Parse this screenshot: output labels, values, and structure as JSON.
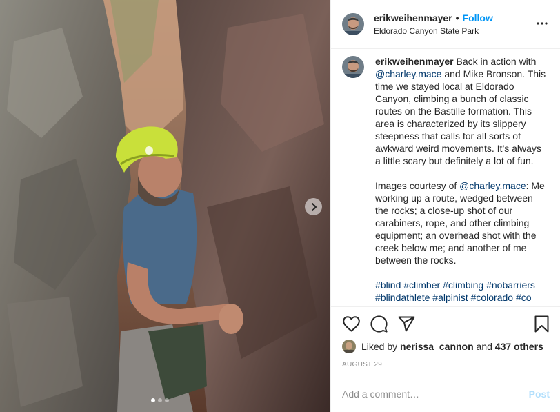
{
  "post": {
    "username": "erikweihenmayer",
    "separator": "•",
    "follow_label": "Follow",
    "location": "Eldorado Canyon State Park",
    "caption": {
      "username": "erikweihenmayer",
      "p1_a": " Back in action with ",
      "mention1": "@charley.mace",
      "p1_b": " and Mike Bronson. This time we stayed local at Eldorado Canyon, climbing a bunch of classic routes on the Bastille formation. This area is characterized by its slippery steepness that calls for all sorts of awkward weird movements. It’s always a little scary but definitely a lot of fun.",
      "p2_a": "Images courtesy of ",
      "mention2": "@charley.mace",
      "p2_b": ": Me working up a route, wedged between the rocks; a close-up shot of our carabiners, rope, and other climbing equipment; an overhead shot with the creek below me; and another of me between the rocks.",
      "hashtags": [
        "#blind",
        "#climber",
        "#climbing",
        "#nobarriers",
        "#blindathlete",
        "#alpinist",
        "#colorado",
        "#co"
      ]
    },
    "likes": {
      "prefix": "Liked by ",
      "liker": "nerissa_cannon",
      "middle": " and ",
      "others": "437 others"
    },
    "date": "AUGUST 29",
    "comment_placeholder": "Add a comment…",
    "post_label": "Post",
    "carousel": {
      "slide_count": 3,
      "active_index": 0
    },
    "icons": {
      "more": "more-options-icon",
      "next": "chevron-right-icon",
      "like": "heart-icon",
      "comment": "comment-bubble-icon",
      "share": "paper-plane-icon",
      "save": "bookmark-icon"
    },
    "colors": {
      "link": "#00376b",
      "follow": "#0095f6",
      "post_disabled": "#b2dffc",
      "muted": "#8e8e8e"
    }
  }
}
